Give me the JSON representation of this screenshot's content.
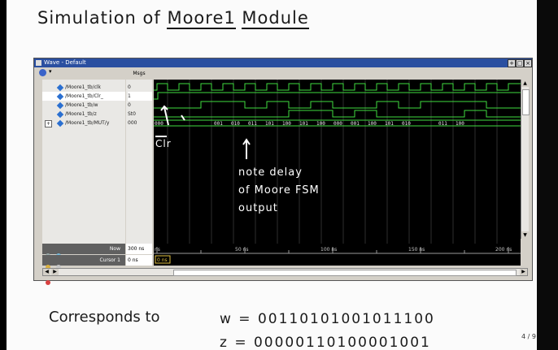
{
  "slide": {
    "title_part1": "Simulation of ",
    "title_underline1": "Moore1",
    "title_underline2": "Module",
    "corresponds_to": "Corresponds to",
    "w_line": "w = 00110101001011100",
    "z_line": "z = 00000110100001001",
    "page_number": "4 / 9"
  },
  "wave_window": {
    "title": "Wave - Default",
    "msgs_header": "Msgs",
    "signals": [
      {
        "name": "/Moore1_tb/clk",
        "value": "0"
      },
      {
        "name": "/Moore1_tb/Clr_",
        "value": "1"
      },
      {
        "name": "/Moore1_tb/w",
        "value": "0"
      },
      {
        "name": "/Moore1_tb/z",
        "value": "St0"
      },
      {
        "name": "/Moore1_tb/MUT/y",
        "value": "000"
      }
    ],
    "now_label": "Now",
    "now_value": "300 ns",
    "cursor_label": "Cursor 1",
    "cursor_value": "0 ns",
    "cursor_marker": "0 ns",
    "timeline_labels": [
      "ns",
      "50 ns",
      "100 ns",
      "150 ns",
      "200 ns"
    ],
    "bus_values": [
      "000",
      "001",
      "010",
      "011",
      "101",
      "100",
      "101",
      "100",
      "000",
      "001",
      "100",
      "101",
      "010",
      "011",
      "100"
    ]
  },
  "annotations": {
    "clr": "Clr",
    "note_line1": "note delay",
    "note_line2": "of Moore FSM",
    "note_line3": "output"
  },
  "colors": {
    "wave_green": "#3fdc3f",
    "wave_background": "#000000",
    "titlebar_blue": "#2a4fa0"
  }
}
